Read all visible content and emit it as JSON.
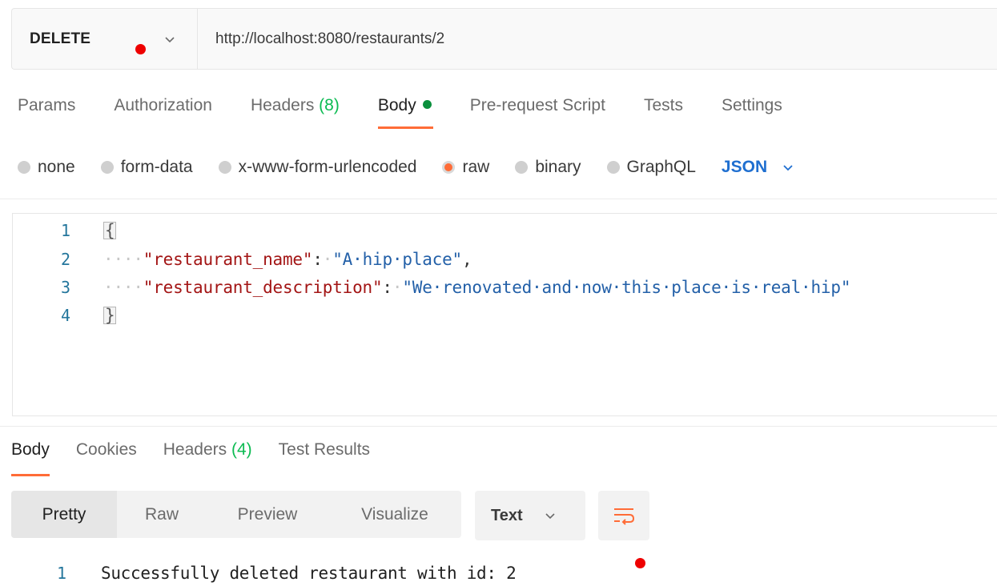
{
  "request": {
    "method": "DELETE",
    "url": "http://localhost:8080/restaurants/2",
    "unsaved_indicator_color": "#ee0000"
  },
  "request_tabs": [
    {
      "label": "Params"
    },
    {
      "label": "Authorization"
    },
    {
      "label": "Headers",
      "count": "(8)"
    },
    {
      "label": "Body",
      "active": true
    },
    {
      "label": "Pre-request Script"
    },
    {
      "label": "Tests"
    },
    {
      "label": "Settings"
    }
  ],
  "body_types": {
    "options": [
      "none",
      "form-data",
      "x-www-form-urlencoded",
      "raw",
      "binary",
      "GraphQL"
    ],
    "selected": "raw",
    "format": "JSON"
  },
  "editor": {
    "line_numbers": [
      "1",
      "2",
      "3",
      "4"
    ],
    "open_brace": "{",
    "close_brace": "}",
    "fields": [
      {
        "key": "\"restaurant_name\"",
        "value": "\"A·hip·place\"",
        "trailing": ","
      },
      {
        "key": "\"restaurant_description\"",
        "value": "\"We·renovated·and·now·this·place·is·real·hip\"",
        "trailing": ""
      }
    ],
    "indent_marker": "····",
    "colon": ":"
  },
  "response_tabs": [
    {
      "label": "Body",
      "active": true
    },
    {
      "label": "Cookies"
    },
    {
      "label": "Headers",
      "count": "(4)"
    },
    {
      "label": "Test Results"
    }
  ],
  "view_modes": [
    "Pretty",
    "Raw",
    "Preview",
    "Visualize"
  ],
  "active_view_mode": "Pretty",
  "response_format": "Text",
  "response": {
    "line_number": "1",
    "text": "Successfully deleted restaurant with id: 2"
  },
  "colors": {
    "accent": "#ff6c37",
    "count_green": "#0cbb52",
    "active_dot_green": "#0a8f3c",
    "json_blue": "#1f6fd0",
    "key_red": "#a31515",
    "string_blue": "#2360a8",
    "line_number": "#24769c"
  }
}
